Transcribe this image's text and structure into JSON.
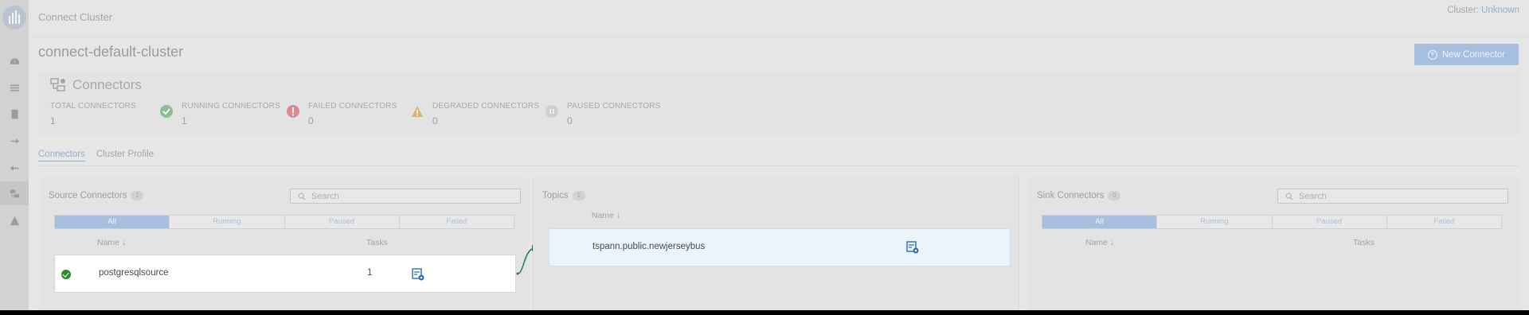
{
  "app": {
    "title": "Connect Cluster"
  },
  "cluster_status": {
    "label": "Cluster:",
    "value": "Unknown"
  },
  "cluster_name": "connect-default-cluster",
  "new_connector_label": "New Connector",
  "summary": {
    "title": "Connectors",
    "stats": [
      {
        "label": "TOTAL CONNECTORS",
        "value": "1"
      },
      {
        "label": "RUNNING CONNECTORS",
        "value": "1",
        "icon": "check-circle-icon",
        "color": "#8ebd8e"
      },
      {
        "label": "FAILED CONNECTORS",
        "value": "0",
        "icon": "error-circle-icon",
        "color": "#db8b8b"
      },
      {
        "label": "DEGRADED CONNECTORS",
        "value": "0",
        "icon": "warning-triangle-icon",
        "color": "#d9b36b"
      },
      {
        "label": "PAUSED CONNECTORS",
        "value": "0",
        "icon": "pause-circle-icon",
        "color": "#c9c9c9"
      }
    ]
  },
  "tabs": [
    {
      "label": "Connectors",
      "active": true
    },
    {
      "label": "Cluster Profile",
      "active": false
    }
  ],
  "source": {
    "title": "Source Connectors",
    "count": "1",
    "search_placeholder": "Search",
    "filters": [
      "All",
      "Running",
      "Paused",
      "Failed"
    ],
    "col_name": "Name ↓",
    "col_tasks": "Tasks",
    "rows": [
      {
        "name": "postgresqlsource",
        "tasks": "1",
        "status": "running"
      }
    ]
  },
  "topics": {
    "title": "Topics",
    "count": "1",
    "col_name": "Name ↓",
    "rows": [
      {
        "name": "tspann.public.newjerseybus"
      }
    ]
  },
  "sink": {
    "title": "Sink Connectors",
    "count": "0",
    "search_placeholder": "Search",
    "filters": [
      "All",
      "Running",
      "Paused",
      "Failed"
    ],
    "col_name": "Name ↓",
    "col_tasks": "Tasks"
  },
  "colors": {
    "accent": "#4a7fc1",
    "success": "#2e8b2e",
    "link_line": "#1f7a4e"
  }
}
